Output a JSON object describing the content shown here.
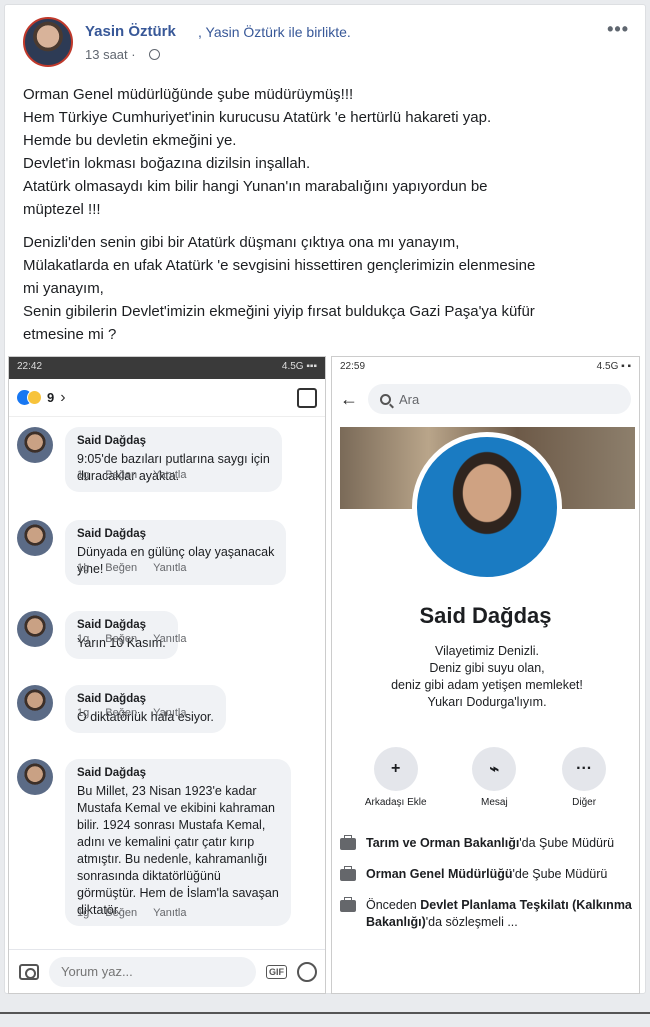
{
  "post": {
    "poster_name": "Yasin Öztürk",
    "with_text": ", Yasin Öztürk ile birlikte.",
    "time": "13 saat ·",
    "more": "•••",
    "paragraphs": [
      [
        "Orman Genel müdürlüğünde şube müdürüymüş!!!",
        "Hem Türkiye Cumhuriyet'inin kurucusu Atatürk 'e hertürlü hakareti yap.",
        "Hemde bu devletin ekmeğini ye.",
        "Devlet'in lokması boğazına dizilsin inşallah.",
        "Atatürk olmasaydı kim bilir hangi Yunan'ın marabalığını yapıyordun be",
        "müptezel !!!"
      ],
      [
        "Denizli'den senin gibi bir Atatürk düşmanı çıktıya ona mı yanayım,",
        "Mülakatlarda en ufak Atatürk 'e sevgisini hissettiren gençlerimizin elenmesine",
        "mi yanayım,",
        "Senin gibilerin Devlet'imizin ekmeğini yiyip fırsat buldukça Gazi Paşa'ya küfür",
        "etmesine mi ?"
      ]
    ]
  },
  "left_phone": {
    "status_time": "22:42",
    "status_right": "4.5G ▪▪▪",
    "reaction_count": "9",
    "comments": [
      {
        "name": "Said Dağdaş",
        "lines": [
          "9:05'de bazıları putlarına saygı için",
          "duracaklar ayakta."
        ]
      },
      {
        "name": "Said Dağdaş",
        "lines": [
          "Dünyada en gülünç olay yaşanacak",
          "yine!"
        ]
      },
      {
        "name": "Said Dağdaş",
        "lines": [
          "Yarın 10 Kasım."
        ]
      },
      {
        "name": "Said Dağdaş",
        "lines": [
          "O diktatörlük hala esiyor."
        ]
      },
      {
        "name": "Said Dağdaş",
        "lines": [
          "Bu Millet, 23 Nisan 1923'e kadar",
          "Mustafa Kemal ve ekibini kahraman",
          "bilir. 1924 sonrası Mustafa Kemal,",
          "adını ve kemalini çatır çatır kırıp",
          "atmıştır. Bu nedenle, kahramanlığı",
          "sonrasında diktatörlüğünü",
          "görmüştür. Hem de İslam'la savaşan",
          "diktatör."
        ]
      }
    ],
    "time_label": "1g",
    "like_label": "Beğen",
    "reply_label": "Yanıtla",
    "comment_placeholder": "Yorum yaz...",
    "gif_label": "GIF"
  },
  "right_phone": {
    "status_time": "22:59",
    "status_right": "4.5G ▪ ▪",
    "search_placeholder": "Ara",
    "profile_name": "Said Dağdaş",
    "bio": [
      "Vilayetimiz Denizli.",
      "Deniz gibi suyu olan,",
      "deniz gibi adam yetişen memleket!",
      "Yukarı Dodurga'lıyım."
    ],
    "actions": [
      {
        "icon": "+",
        "label": "Arkadaşı Ekle"
      },
      {
        "icon": "⌁",
        "label": "Mesaj"
      },
      {
        "icon": "···",
        "label": "Diğer"
      }
    ],
    "info": [
      {
        "bold": "Tarım ve Orman Bakanlığı",
        "rest": "'da Şube Müdürü"
      },
      {
        "bold": "Orman Genel Müdürlüğü",
        "rest": "'de Şube Müdürü"
      },
      {
        "prefix": "Önceden ",
        "bold": "Devlet Planlama Teşkilatı (Kalkınma Bakanlığı)",
        "rest": "'da sözleşmeli ..."
      }
    ]
  }
}
